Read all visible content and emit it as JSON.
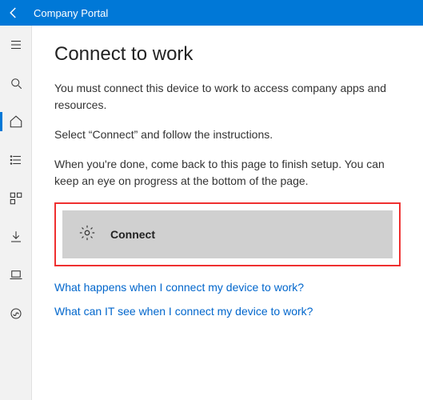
{
  "titlebar": {
    "title": "Company Portal"
  },
  "page": {
    "heading": "Connect to work",
    "para1": "You must connect this device to work to access company apps and resources.",
    "para2": "Select “Connect” and follow the instructions.",
    "para3": "When you're done, come back to this page to finish setup. You can keep an eye on progress at the bottom of the page."
  },
  "connect": {
    "label": "Connect"
  },
  "links": {
    "link1": "What happens when I connect my device to work?",
    "link2": "What can IT see when I connect my device to work?"
  },
  "sidebar_icons": [
    "hamburger-icon",
    "search-icon",
    "home-icon",
    "list-icon",
    "apps-icon",
    "download-icon",
    "laptop-icon",
    "support-icon"
  ]
}
